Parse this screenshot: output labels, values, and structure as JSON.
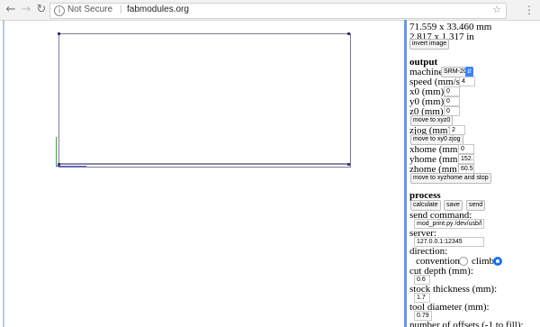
{
  "browser": {
    "security_label": "Not Secure",
    "separator": "|",
    "host": "fabmodules.org"
  },
  "icons": {
    "back": "back-arrow-icon",
    "forward": "forward-arrow-icon",
    "reload": "reload-icon",
    "info": "info-icon",
    "star": "bookmark-star-icon",
    "menu": "kebab-menu-icon"
  },
  "colors": {
    "divider": "#6699dd",
    "radio_selected": "#1a73e8",
    "axis_y": "#33aa33",
    "axis_x": "#5555dd"
  },
  "image_info": {
    "size_mm": "71.559 x 33.460 mm",
    "size_in": "2.817 x 1.317 in",
    "invert_label": "invert image"
  },
  "output": {
    "heading": "output",
    "machine_label": "machine",
    "machine_value": "SRM-20",
    "speed_label": "speed (mm/s):",
    "speed_value": "4",
    "x0_label": "x0 (mm):",
    "x0_value": "0",
    "y0_label": "y0 (mm):",
    "y0_value": "0",
    "z0_label": "z0 (mm):",
    "z0_value": "0",
    "move_xyz0_label": "move to xyz0",
    "zjog_label": "zjog (mm):",
    "zjog_value": "2",
    "move_xy0_label": "move to xy0 zjog",
    "xhome_label": "xhome (mm):",
    "xhome_value": "0",
    "yhome_label": "yhome (mm):",
    "yhome_value": "152.",
    "zhome_label": "zhome (mm):",
    "zhome_value": "60.5",
    "move_home_label": "move to xyzhome and stop"
  },
  "process": {
    "heading": "process",
    "calculate_label": "calculate",
    "save_label": "save",
    "send_label": "send",
    "send_command_label": "send command:",
    "send_command_value": "mod_print.py /dev/usb/l",
    "server_label": "server:",
    "server_value": "127.0.0.1:12345",
    "direction_label": "direction:",
    "conventional_label": "conventional",
    "climb_label": "climb",
    "cut_depth_label": "cut depth (mm):",
    "cut_depth_value": "0.6",
    "stock_label": "stock thickness (mm):",
    "stock_value": "1.7",
    "tool_label": "tool diameter (mm):",
    "tool_value": "0.79",
    "offsets_label": "number of offsets (-1 to fill):"
  }
}
